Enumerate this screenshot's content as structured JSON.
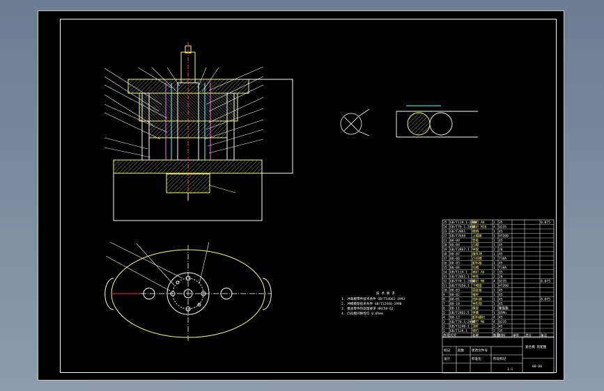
{
  "drawing": {
    "tech_req_title": "技 术 要 求",
    "tech_req": [
      "1. 冲裁模零件技术条件 GB/T14662-1993",
      "2. 冲模模架技术条件 GB/T12446-1990",
      "3. 模具零件热处理要求 HRC58-62",
      "4. 凸凹模间隙均匀 0.05mm"
    ],
    "drawing_no": "00-00",
    "title_block": {
      "title": "复合模 装配图",
      "row1": [
        "标记",
        "处数",
        "分区",
        "更改文件号",
        "签名",
        "年月日"
      ],
      "row2": [
        "设计",
        "",
        "标准化",
        "",
        "阶段标记",
        "重量",
        "比例"
      ],
      "scale": "1:1"
    }
  },
  "bom": {
    "headers": [
      "序号",
      "代号",
      "名称",
      "数量",
      "材料",
      "单件",
      "总计",
      "备注"
    ],
    "rows": [
      [
        "25",
        "GB/T119.1-2000",
        "销钉 A8",
        "2",
        "35",
        "",
        "",
        "0.075"
      ],
      [
        "24",
        "GB/T70.1-2000",
        "螺钉 M10",
        "4",
        "Q235",
        "",
        "",
        ""
      ],
      [
        "23",
        "GB/T2861",
        "模柄",
        "1",
        "45",
        "",
        "",
        ""
      ],
      [
        "22",
        "GB/T7650",
        "上模座",
        "1",
        "HT200",
        "",
        "",
        ""
      ],
      [
        "21",
        "00-09",
        "垫板",
        "1",
        "45",
        "",
        "",
        ""
      ],
      [
        "20",
        "00-08",
        "凸模",
        "1",
        "45",
        "",
        "",
        ""
      ],
      [
        "19",
        "GB/T2867.1",
        "导套",
        "2",
        "20",
        "",
        "",
        ""
      ],
      [
        "18",
        "00-07",
        "推件块",
        "1",
        "45",
        "",
        "",
        ""
      ],
      [
        "17",
        "00-06",
        "凸凹模",
        "1",
        "T10A",
        "",
        "",
        ""
      ],
      [
        "16",
        "00-05",
        "卸料板",
        "1",
        "45",
        "",
        "",
        ""
      ],
      [
        "15",
        "00-04",
        "凹模",
        "1",
        "T10A",
        "",
        "",
        ""
      ],
      [
        "14",
        "GB/T119.1",
        "销钉 A6",
        "2",
        "35",
        "",
        "",
        ""
      ],
      [
        "13",
        "GB/T2861.1",
        "导柱",
        "2",
        "20",
        "",
        "",
        ""
      ],
      [
        "12",
        "GB/T70.1-2000",
        "螺钉 M8",
        "4",
        "Q235",
        "",
        "",
        "0.075"
      ],
      [
        "11",
        "GB/T7650.1",
        "下模座",
        "1",
        "HT200",
        "",
        "",
        ""
      ],
      [
        "10",
        "00-03",
        "固定板",
        "1",
        "45",
        "",
        "",
        ""
      ],
      [
        "9",
        "00-02",
        "推杆",
        "1",
        "45",
        "",
        "",
        ""
      ],
      [
        "8",
        "00-01",
        "挡料销",
        "1",
        "45",
        "",
        "",
        "0.075"
      ],
      [
        "7",
        "00-10",
        "导料销",
        "1",
        "45",
        "",
        "",
        ""
      ],
      [
        "6",
        "00-11",
        "橡胶",
        "1",
        "聚氨酯",
        "",
        "",
        ""
      ],
      [
        "5",
        "GB/T2861.5",
        "弹簧",
        "1",
        "65Mn",
        "",
        "",
        ""
      ],
      [
        "4",
        "00-12",
        "卸料螺钉",
        "4",
        "45",
        "",
        "",
        ""
      ],
      [
        "3",
        "GB/T70.1-2000",
        "螺钉 M6",
        "4",
        "Q235",
        "",
        "",
        ""
      ],
      [
        "2",
        "GB/T1240-1",
        "顶杆",
        "2",
        "45",
        "",
        "",
        ""
      ],
      [
        "1",
        "GB/T119.1",
        "销钉",
        "2",
        "35",
        "",
        "",
        ""
      ]
    ],
    "footer": [
      "序号",
      "代号",
      "名称",
      "数量",
      "材料",
      "单件",
      "总计",
      "备注"
    ]
  }
}
